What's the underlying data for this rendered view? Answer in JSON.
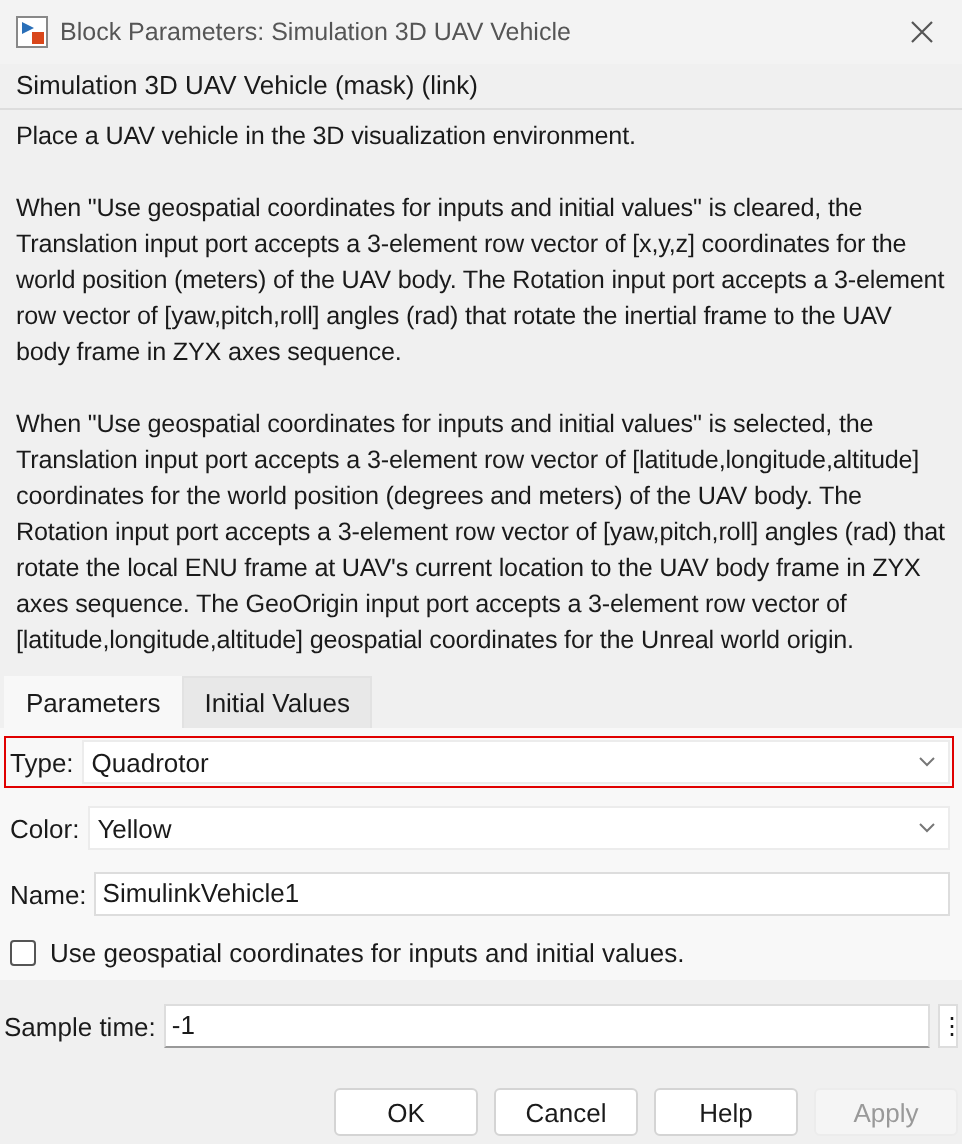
{
  "window": {
    "title": "Block Parameters: Simulation 3D UAV Vehicle"
  },
  "block_title": "Simulation 3D UAV Vehicle (mask) (link)",
  "description": [
    "Place a UAV vehicle in the 3D visualization environment.",
    "When \"Use geospatial coordinates for inputs and initial values\" is cleared, the Translation input port accepts a 3-element row vector of [x,y,z] coordinates for the world position (meters) of the UAV body. The Rotation input port accepts a 3-element row vector of [yaw,pitch,roll] angles (rad) that rotate the inertial frame to the UAV body frame in ZYX axes sequence.",
    "When \"Use geospatial coordinates for inputs and initial values\" is selected, the Translation input port accepts a 3-element row vector of [latitude,longitude,altitude] coordinates for the world position (degrees and meters) of the UAV body. The Rotation input port accepts a 3-element row vector of [yaw,pitch,roll] angles (rad) that rotate the local ENU frame at UAV's current location to the UAV body frame in ZYX axes sequence. The GeoOrigin input port accepts a 3-element row vector of [latitude,longitude,altitude] geospatial coordinates for the Unreal world origin."
  ],
  "tabs": [
    {
      "label": "Parameters",
      "selected": true
    },
    {
      "label": "Initial Values",
      "selected": false
    }
  ],
  "parameters": [
    {
      "kind": "dropdown",
      "label": "Type:",
      "value": "Quadrotor",
      "highlighted": true
    },
    {
      "kind": "dropdown",
      "label": "Color:",
      "value": "Yellow",
      "highlighted": false
    },
    {
      "kind": "text",
      "label": "Name:",
      "value": "SimulinkVehicle1",
      "highlighted": false
    },
    {
      "kind": "checkbox",
      "label": "Use geospatial coordinates for inputs and initial values.",
      "checked": false,
      "highlighted": false
    }
  ],
  "sample_time": {
    "label": "Sample time:",
    "value": "-1",
    "menu": "⋮"
  },
  "buttons": [
    {
      "label": "OK",
      "disabled": false
    },
    {
      "label": "Cancel",
      "disabled": false
    },
    {
      "label": "Help",
      "disabled": false
    },
    {
      "label": "Apply",
      "disabled": true
    }
  ]
}
